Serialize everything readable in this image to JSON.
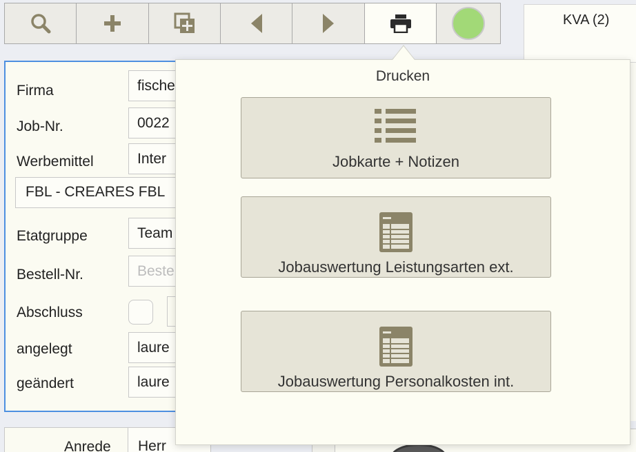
{
  "toolbar": {
    "buttons": [
      {
        "icon": "search-icon"
      },
      {
        "icon": "plus-icon"
      },
      {
        "icon": "duplicate-icon"
      },
      {
        "icon": "arrow-left-icon"
      },
      {
        "icon": "arrow-right-icon"
      },
      {
        "icon": "print-icon",
        "active": true
      },
      {
        "icon": "status-dot",
        "color": "#a2d977"
      }
    ]
  },
  "kva": {
    "label": "KVA (2)"
  },
  "form": {
    "firma_label": "Firma",
    "firma_value": "fische",
    "jobnr_label": "Job-Nr.",
    "jobnr_value": "0022",
    "werbemittel_label": "Werbemittel",
    "werbemittel_value": "Inter",
    "description_value": "FBL - CREARES FBL",
    "etatgruppe_label": "Etatgruppe",
    "etatgruppe_value": "Team",
    "bestellnr_label": "Bestell-Nr.",
    "bestellnr_placeholder": "Beste",
    "abschluss_label": "Abschluss",
    "angelegt_label": "angelegt",
    "angelegt_value": "laure",
    "geaendert_label": "geändert",
    "geaendert_value": "laure"
  },
  "contact": {
    "anrede_label": "Anrede",
    "anrede_value": "Herr"
  },
  "popover": {
    "title": "Drucken",
    "options": [
      {
        "label": "Jobkarte + Notizen",
        "icon": "list-icon"
      },
      {
        "label": "Jobauswertung Leistungsarten ext.",
        "icon": "spreadsheet-icon"
      },
      {
        "label": "Jobauswertung Personalkosten int.",
        "icon": "spreadsheet-icon"
      }
    ]
  },
  "colors": {
    "icon": "#8b8468",
    "accent_border": "#4d8fe0",
    "status": "#a2d977",
    "popover_button": "#e6e4d7"
  }
}
